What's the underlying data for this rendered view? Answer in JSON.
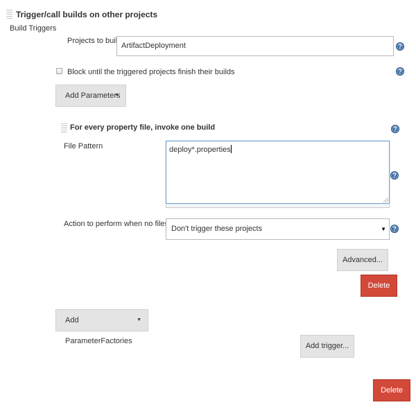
{
  "section": {
    "title": "Trigger/call builds on other projects",
    "subtitle": "Build Triggers"
  },
  "projects": {
    "label": "Projects to build",
    "value": "ArtifactDeployment"
  },
  "block": {
    "label": "Block until the triggered projects finish their builds",
    "checked": false
  },
  "add_parameters": {
    "label": "Add Parameters",
    "arrow": "▼"
  },
  "property_file": {
    "title": "For every property file, invoke one build",
    "pattern_label": "File Pattern",
    "pattern_value": "deploy*.properties",
    "no_files_label": "Action to perform when no files found",
    "no_files_value": "Don't trigger these projects",
    "select_arrow": "▼",
    "advanced_label": "Advanced...",
    "delete_label": "Delete"
  },
  "add_parameter_factories": {
    "label": "Add ParameterFactories",
    "arrow": "▼"
  },
  "add_trigger": {
    "label": "Add trigger..."
  },
  "delete_bottom": {
    "label": "Delete"
  },
  "help_icon_glyph": "?",
  "colors": {
    "delete_red": "#d24939",
    "button_gray": "#e4e4e4",
    "help_blue": "#3a6aa0"
  }
}
